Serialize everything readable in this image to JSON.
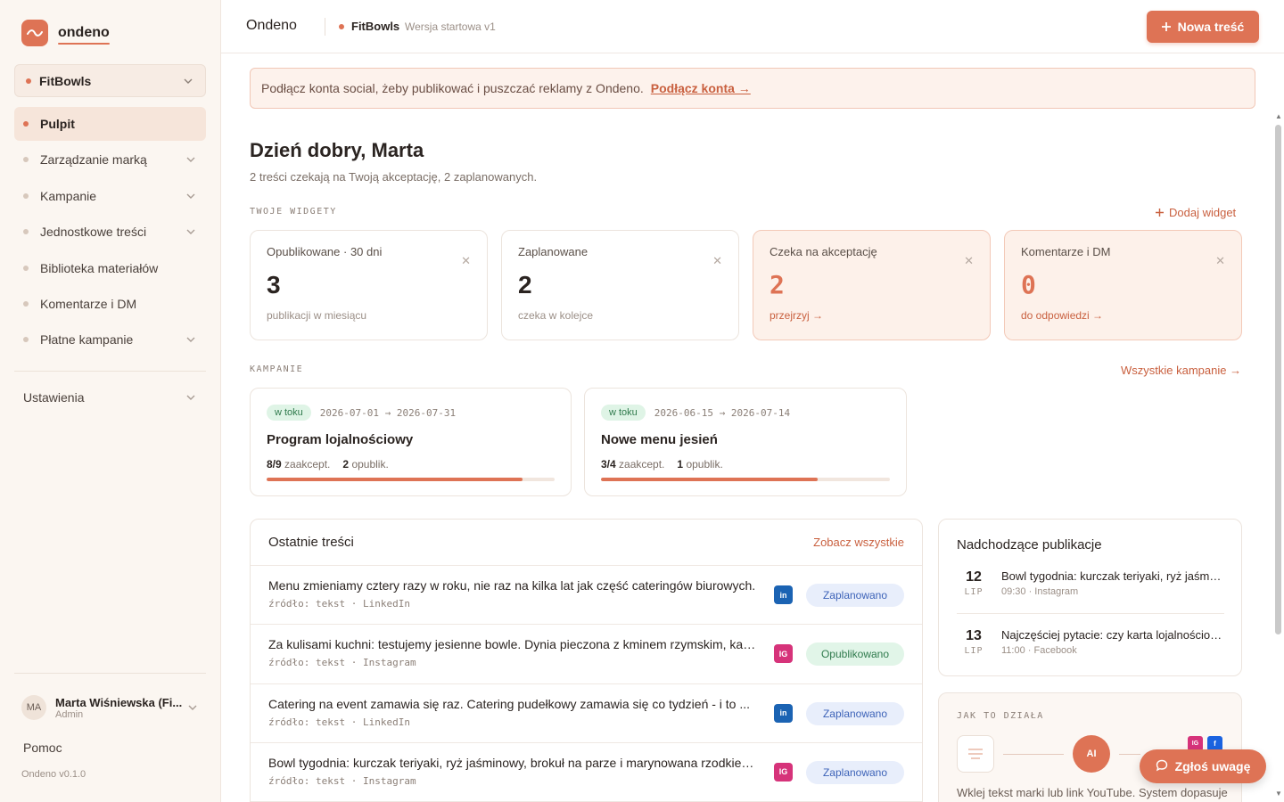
{
  "sidebar": {
    "logo_text": "ondeno",
    "brand": "FitBowls",
    "nav": [
      {
        "label": "Pulpit",
        "active": true,
        "chevron": false
      },
      {
        "label": "Zarządzanie marką",
        "active": false,
        "chevron": true
      },
      {
        "label": "Kampanie",
        "active": false,
        "chevron": true
      },
      {
        "label": "Jednostkowe treści",
        "active": false,
        "chevron": true
      },
      {
        "label": "Biblioteka materiałów",
        "active": false,
        "chevron": false
      },
      {
        "label": "Komentarze i DM",
        "active": false,
        "chevron": false
      },
      {
        "label": "Płatne kampanie",
        "active": false,
        "chevron": true
      }
    ],
    "settings": "Ustawienia",
    "user": {
      "initials": "MA",
      "name": "Marta Wiśniewska (Fi...",
      "role": "Admin"
    },
    "help": "Pomoc",
    "version": "Ondeno v0.1.0"
  },
  "topbar": {
    "title": "Ondeno",
    "brand": "FitBowls",
    "version": "Wersja startowa v1",
    "new_button": "Nowa treść"
  },
  "banner": {
    "text": "Podłącz konta social, żeby publikować i puszczać reklamy z Ondeno.",
    "link": "Podłącz konta →"
  },
  "greeting": "Dzień dobry, Marta",
  "subgreeting": "2 treści czekają na Twoją akceptację, 2 zaplanowanych.",
  "widgets_section": {
    "label": "TWOJE WIDGETY",
    "add": "Dodaj widget"
  },
  "widgets": [
    {
      "title": "Opublikowane · 30 dni",
      "value": "3",
      "sub": "publikacji w miesiącu",
      "highlight": false
    },
    {
      "title": "Zaplanowane",
      "value": "2",
      "sub": "czeka w kolejce",
      "highlight": false
    },
    {
      "title": "Czeka na akceptację",
      "value": "2",
      "sub": "przejrzyj →",
      "highlight": true
    },
    {
      "title": "Komentarze i DM",
      "value": "0",
      "sub": "do odpowiedzi →",
      "highlight": true
    }
  ],
  "campaigns_section": {
    "label": "KAMPANIE",
    "link": "Wszystkie kampanie →"
  },
  "campaigns": [
    {
      "status": "w toku",
      "dates": "2026-07-01 → 2026-07-31",
      "name": "Program lojalnościowy",
      "accepted": "8/9",
      "accepted_label": "zaakcept.",
      "published": "2",
      "published_label": "opublik.",
      "progress": 0.89
    },
    {
      "status": "w toku",
      "dates": "2026-06-15 → 2026-07-14",
      "name": "Nowe menu jesień",
      "accepted": "3/4",
      "accepted_label": "zaakcept.",
      "published": "1",
      "published_label": "opublik.",
      "progress": 0.75
    }
  ],
  "recent": {
    "title": "Ostatnie treści",
    "link": "Zobacz wszystkie",
    "rows": [
      {
        "title": "Menu zmieniamy cztery razy w roku, nie raz na kilka lat jak część cateringów biurowych.",
        "source": "źródło: tekst · LinkedIn",
        "network": "in",
        "status": "Zaplanowano",
        "status_type": "plan"
      },
      {
        "title": "Za kulisami kuchni: testujemy jesienne bowle. Dynia pieczona z kminem rzymskim, kasza.",
        "source": "źródło: tekst · Instagram",
        "network": "IG",
        "status": "Opublikowano",
        "status_type": "pub"
      },
      {
        "title": "Catering na event zamawia się raz. Catering pudełkowy zamawia się co tydzień - i to ...",
        "source": "źródło: tekst · LinkedIn",
        "network": "in",
        "status": "Zaplanowano",
        "status_type": "plan"
      },
      {
        "title": "Bowl tygodnia: kurczak teriyaki, ryż jaśminowy, brokuł na parze i marynowana rzodkiewka.",
        "source": "źródło: tekst · Instagram",
        "network": "IG",
        "status": "Zaplanowano",
        "status_type": "plan"
      }
    ]
  },
  "upcoming": {
    "title": "Nadchodzące publikacje",
    "items": [
      {
        "day": "12",
        "month": "LIP",
        "title": "Bowl tygodnia: kurczak teriyaki, ryż jaśminowy",
        "meta": "09:30 · Instagram"
      },
      {
        "day": "13",
        "month": "LIP",
        "title": "Najczęściej pytacie: czy karta lojalnościowa",
        "meta": "11:00 · Facebook"
      }
    ]
  },
  "how": {
    "label": "JAK TO DZIAŁA",
    "ai": "AI",
    "ig": "IG",
    "fb": "f",
    "text": "Wklej tekst marki lub link YouTube. System dopasuje"
  },
  "feedback_button": "Zgłoś uwagę",
  "colors": {
    "accent": "#de7355",
    "accent_dark": "#c9603f",
    "sidebar_bg": "#fbf6f1"
  }
}
